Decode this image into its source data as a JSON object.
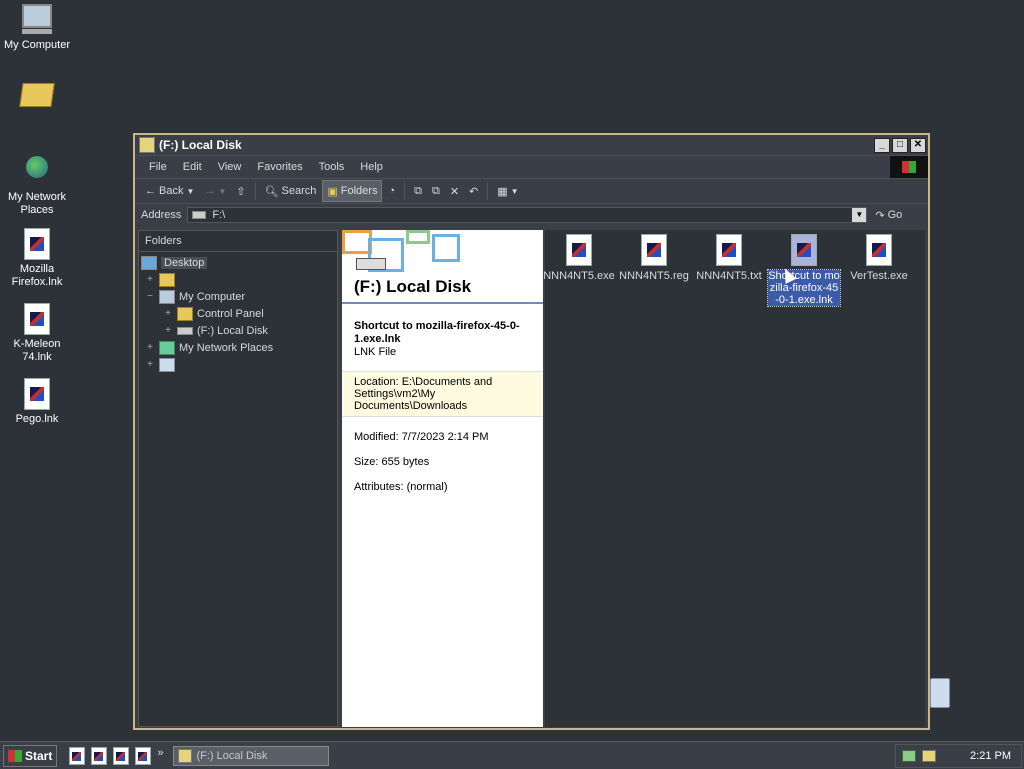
{
  "desktop": {
    "icons": [
      {
        "label": "My Computer"
      },
      {
        "label": ""
      },
      {
        "label": "My Network Places"
      },
      {
        "label": "Mozilla Firefox.lnk"
      },
      {
        "label": "K-Meleon 74.lnk"
      },
      {
        "label": "Pego.lnk"
      }
    ]
  },
  "window": {
    "title": "(F:) Local Disk",
    "menu": [
      "File",
      "Edit",
      "View",
      "Favorites",
      "Tools",
      "Help"
    ],
    "toolbar": {
      "back": "Back",
      "search": "Search",
      "folders": "Folders"
    },
    "address": {
      "label": "Address",
      "value": "F:\\",
      "go": "Go"
    },
    "folders_pane": {
      "header": "Folders",
      "tree": [
        {
          "label": "Desktop",
          "level": 0,
          "expander": ""
        },
        {
          "label": "",
          "level": 1,
          "expander": "+"
        },
        {
          "label": "My Computer",
          "level": 1,
          "expander": "−"
        },
        {
          "label": "Control Panel",
          "level": 2,
          "expander": "+"
        },
        {
          "label": "(F:) Local Disk",
          "level": 2,
          "expander": "+"
        },
        {
          "label": "My Network Places",
          "level": 1,
          "expander": "+"
        },
        {
          "label": "",
          "level": 1,
          "expander": "+"
        }
      ]
    },
    "preview": {
      "title": "(F:) Local Disk",
      "item_name": "Shortcut to mozilla-firefox-45-0-1.exe.lnk",
      "item_type": "LNK File",
      "location": "Location: E:\\Documents and Settings\\vm2\\My Documents\\Downloads",
      "modified": "Modified: 7/7/2023 2:14 PM",
      "size": "Size: 655 bytes",
      "attributes": "Attributes: (normal)"
    },
    "files": [
      {
        "label": "NNN4NT5.exe"
      },
      {
        "label": "NNN4NT5.reg"
      },
      {
        "label": "NNN4NT5.txt"
      },
      {
        "label": "Shortcut to mozilla-firefox-45-0-1.exe.lnk",
        "selected": true
      },
      {
        "label": "VerTest.exe"
      }
    ]
  },
  "taskbar": {
    "start": "Start",
    "task": "(F:) Local Disk",
    "chevron": "»",
    "clock": "2:21 PM"
  }
}
